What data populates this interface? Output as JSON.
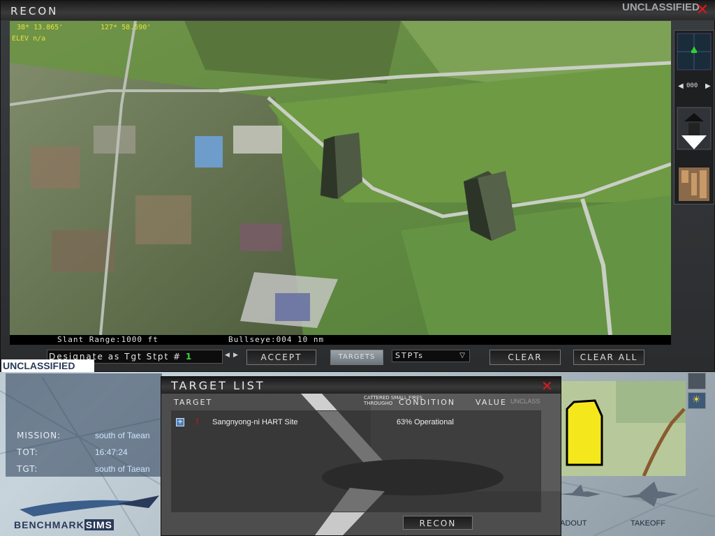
{
  "recon": {
    "title": "RECON",
    "classification": "UNCLASSIFIED",
    "hud": {
      "lat": "38* 13.865'",
      "lon": "127* 58.590'",
      "elev": "ELEV n/a"
    },
    "status": {
      "slant_range": "Slant Range:1000 ft",
      "bullseye": "Bullseye:004",
      "distance": "10 nm"
    },
    "heading_readout": "000",
    "controls": {
      "designate_label": "Designate as Tgt Stpt #",
      "stpt_number": "1",
      "accept": "ACCEPT",
      "targets": "TARGETS",
      "stpts": "STPTs",
      "clear": "CLEAR",
      "clear_all": "CLEAR ALL"
    }
  },
  "briefing": {
    "classification": "UNCLASSIFIED",
    "rows": [
      {
        "label": "MISSION:",
        "value": "south of Taean"
      },
      {
        "label": "TOT:",
        "value": "16:47:24"
      },
      {
        "label": "TGT:",
        "value": "south of Taean"
      }
    ],
    "logo": {
      "left": "BENCHMARK",
      "right": "SIMS"
    },
    "nav": {
      "loadout": "ADOUT",
      "takeoff": "TAKEOFF"
    },
    "bg_text": {
      "fires": "CATTERED SMALL FIRES",
      "throughout": "THROUGHO",
      "unclass": "UNCLASS"
    }
  },
  "target_list": {
    "title": "TARGET LIST",
    "headers": {
      "target": "TARGET",
      "condition": "CONDITION",
      "value": "VALUE"
    },
    "rows": [
      {
        "expand": "+",
        "name": "Sangnyong-ni HART Site",
        "condition": "63% Operational",
        "value": ""
      }
    ],
    "recon_button": "RECON"
  },
  "colors": {
    "hud_yellow": "#e8e03a",
    "close_red": "#e01818",
    "stpt_green": "#3bd63b",
    "map_yellow": "#f4e81c"
  }
}
